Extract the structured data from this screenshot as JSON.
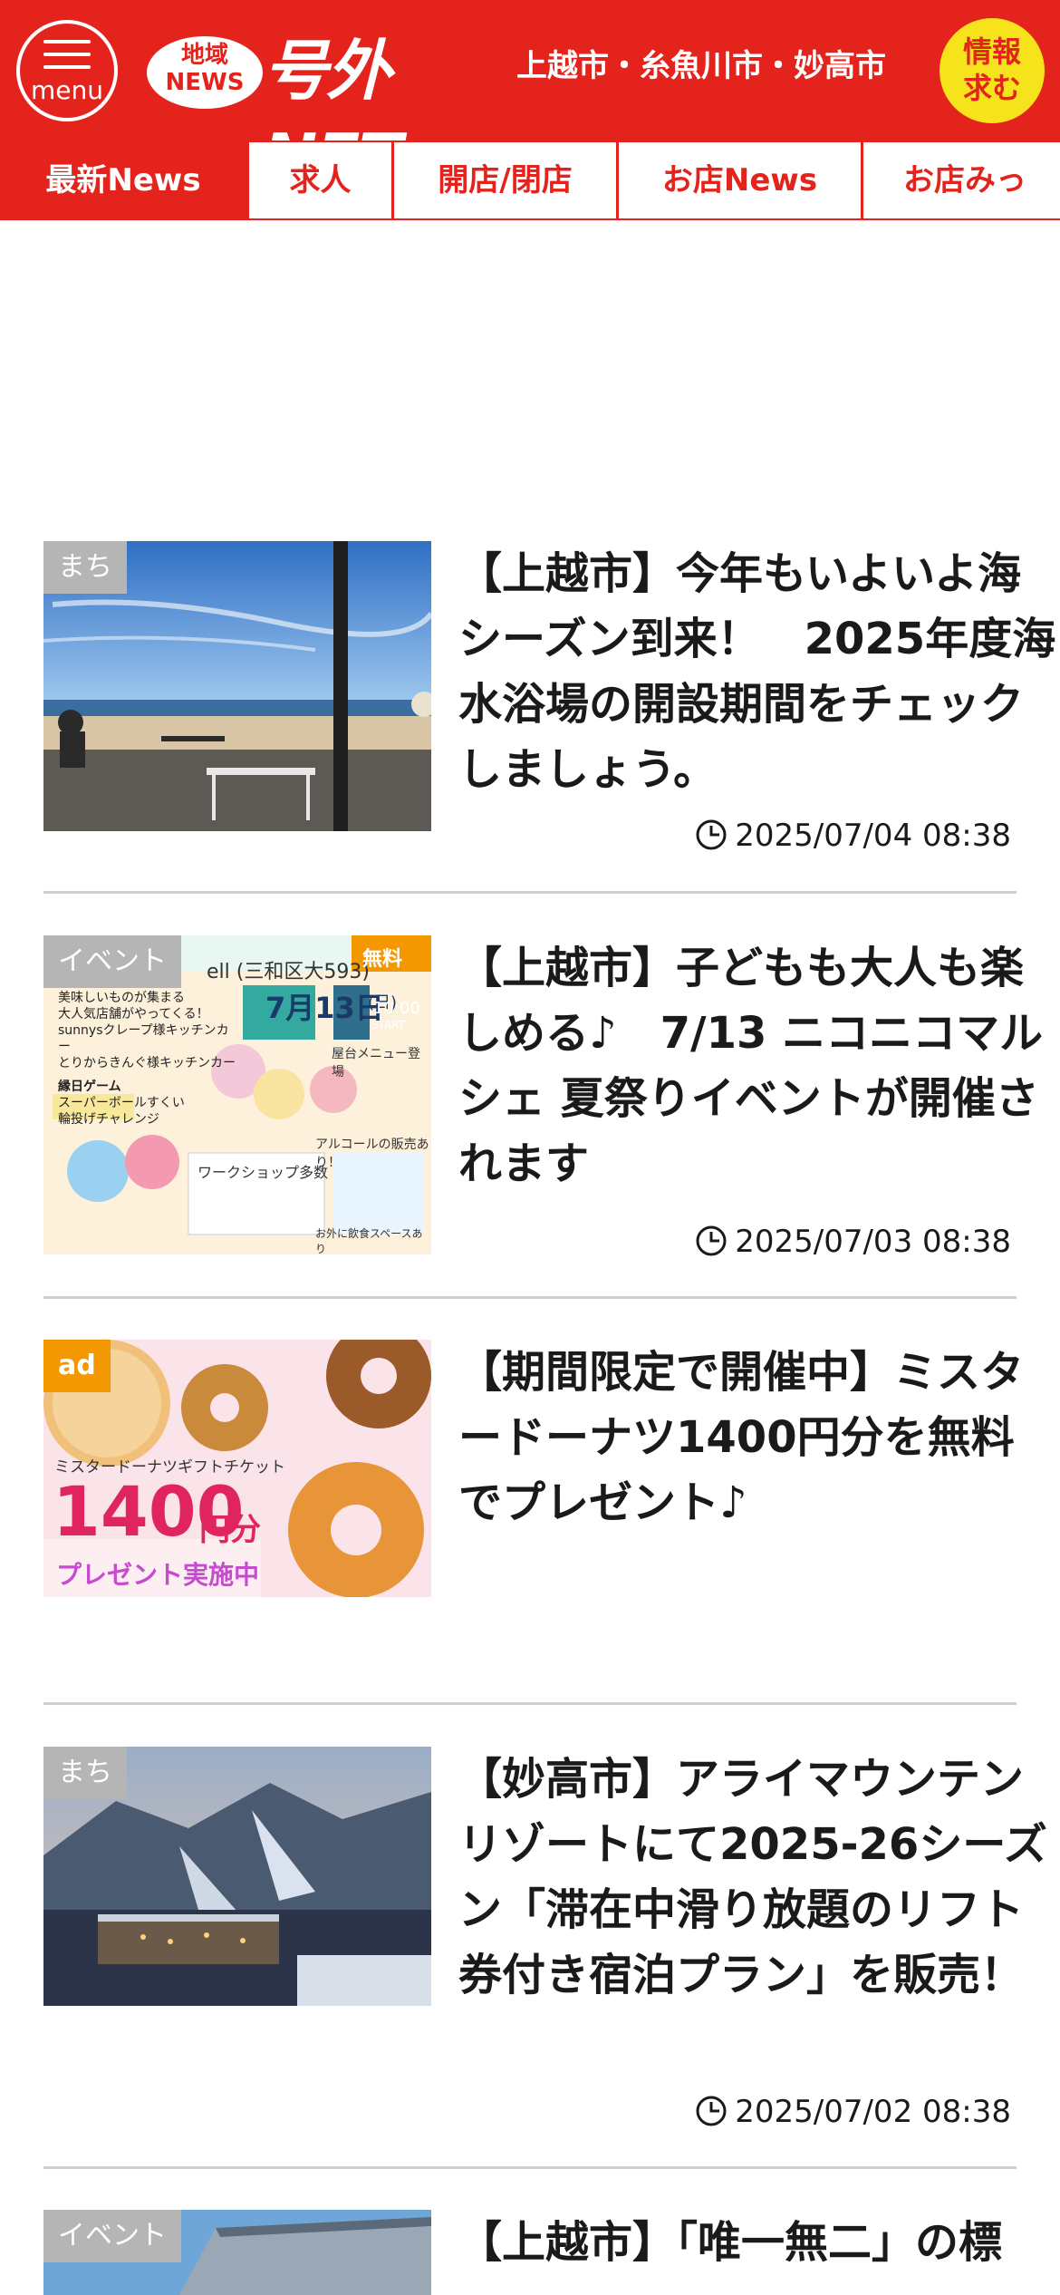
{
  "header": {
    "menu_label": "menu",
    "logo_badge_line1": "地域",
    "logo_badge_line2": "NEWS",
    "logo_text": "号外NET",
    "cities": "上越市・糸魚川市・妙高市",
    "info_line1": "情報",
    "info_line2": "求む",
    "brand_color": "#e4231c",
    "accent_color": "#f7e31c"
  },
  "tabs": [
    {
      "label": "最新News",
      "active": true
    },
    {
      "label": "求人",
      "active": false
    },
    {
      "label": "開店/閉店",
      "active": false
    },
    {
      "label": "お店News",
      "active": false
    },
    {
      "label": "お店みっ",
      "active": false
    }
  ],
  "articles": [
    {
      "tag": "まち",
      "title": "【上越市】今年もいよいよ海シーズン到来！　2025年度海水浴場の開設期間をチェックしましょう。",
      "date": "2025/07/04 08:38",
      "image": "beach-photo"
    },
    {
      "tag": "イベント",
      "title": "【上越市】子どもも大人も楽しめる♪　7/13 ニコニコマルシェ 夏祭りイベントが開催されます",
      "date": "2025/07/03 08:38",
      "image": "event-flyer",
      "flyer": {
        "venue": "ell (三和区大593)",
        "date_text": "7月13日",
        "day": "(日)",
        "time": "10:00",
        "start": "START",
        "badge": "無料",
        "lines": [
          "美味しいものが集まる",
          "大人気店舗がやってくる！",
          "sunnysクレープ様キッチンカー",
          "とりからきんぐ様キッチンカー",
          "縁日ゲーム",
          "スーパーボールすくい",
          "輪投げチャレンジ",
          "ワークショップ多数",
          "屋台メニュー登場",
          "アルコールの販売あり！",
          "お外に飲食スペースあり"
        ]
      }
    },
    {
      "tag": "ad",
      "title": "【期間限定で開催中】ミスタードーナツ1400円分を無料でプレゼント♪",
      "date": "",
      "image": "donut-ad",
      "ad": {
        "small_text": "ミスタードーナツギフトチケット",
        "amount": "1400",
        "unit": "円分",
        "caption": "プレゼント実施中"
      }
    },
    {
      "tag": "まち",
      "title": "【妙高市】アライマウンテンリゾートにて2025-26シーズン「滞在中滑り放題のリフト券付き宿泊プラン」を販売！",
      "date": "2025/07/02 08:38",
      "image": "ski-resort-photo"
    },
    {
      "tag": "イベント",
      "title": "【上越市】「唯一無二」の標",
      "date": "",
      "image": "building-photo"
    }
  ]
}
